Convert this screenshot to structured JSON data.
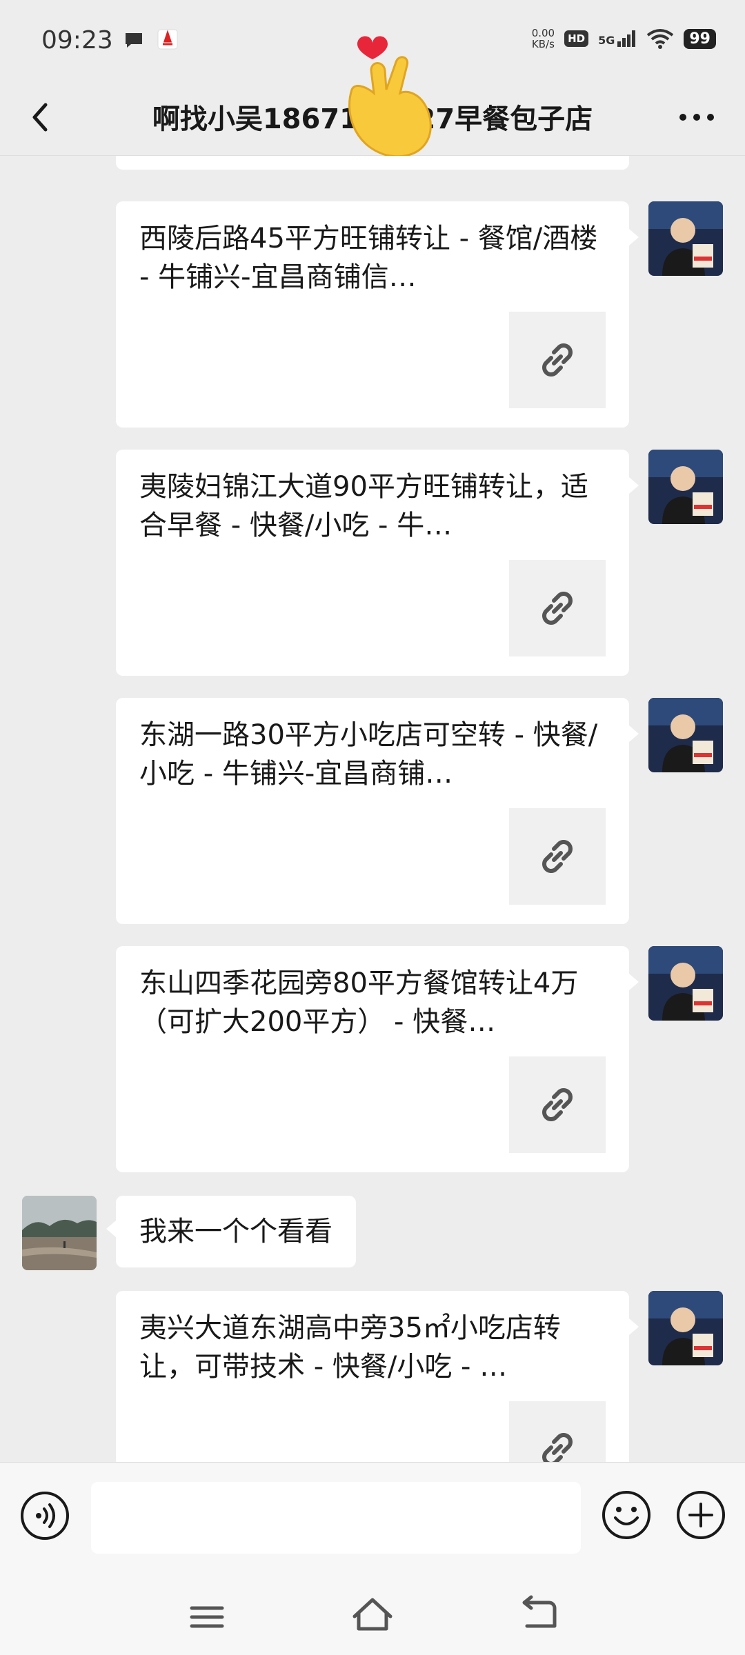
{
  "status_bar": {
    "time": "09:23",
    "net_speed_value": "0.00",
    "net_speed_unit": "KB/s",
    "hd": "HD",
    "signal": "5G",
    "battery": "99"
  },
  "header": {
    "title": "啊找小吴1867127727早餐包子店"
  },
  "messages": [
    {
      "title": "西陵后路45平方旺铺转让 - 餐馆/酒楼 - 牛铺兴-宜昌商铺信…"
    },
    {
      "title": "夷陵妇锦江大道90平方旺铺转让，适合早餐 - 快餐/小吃 - 牛…"
    },
    {
      "title": "东湖一路30平方小吃店可空转 - 快餐/小吃 - 牛铺兴-宜昌商铺…"
    },
    {
      "title": "东山四季花园旁80平方餐馆转让4万（可扩大200平方） - 快餐…"
    },
    {
      "text": "我来一个个看看"
    },
    {
      "title": "夷兴大道东湖高中旁35㎡小吃店转让，可带技术 - 快餐/小吃 - …"
    }
  ],
  "icons": {
    "back": "chevron-left-icon",
    "more": "more-dots-icon",
    "link": "link-icon",
    "voice": "voice-icon",
    "emoji": "emoji-icon",
    "plus": "plus-icon"
  },
  "colors": {
    "background": "#ededed",
    "bubble": "#ffffff",
    "link_tile": "#f0f0f0"
  }
}
